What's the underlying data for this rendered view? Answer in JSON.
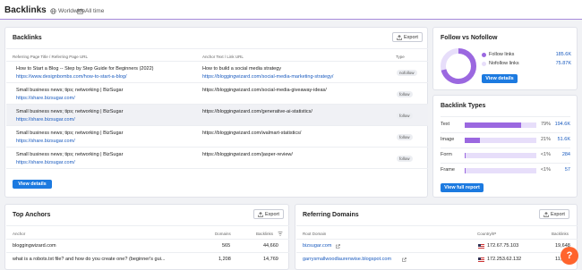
{
  "header": {
    "title": "Backlinks",
    "scope": "Worldwide",
    "period": "All time"
  },
  "backlinks": {
    "title": "Backlinks",
    "export_label": "Export",
    "columns": [
      "Referring Page Title / Referring Page URL",
      "Anchor Text / Link URL",
      "Type"
    ],
    "rows": [
      {
        "title": "How to Start a Blog -- Step by Step Guide for Beginners (2022)",
        "url": "https://www.designbombs.com/how-to-start-a-blog/",
        "anchor": "How to build a social media strategy",
        "link": "https://bloggingwizard.com/social-media-marketing-strategy/",
        "type": "nofollow"
      },
      {
        "title": "Small business news; tips; networking | BizSugar",
        "url": "https://share.bizsugar.com/",
        "anchor": "https://bloggingwizard.com/social-media-giveaway-ideas/",
        "link": "",
        "type": "follow"
      },
      {
        "title": "Small business news; tips; networking | BizSugar",
        "url": "https://share.bizsugar.com/",
        "anchor": "https://bloggingwizard.com/generative-ai-statistics/",
        "link": "",
        "type": "follow"
      },
      {
        "title": "Small business news; tips; networking | BizSugar",
        "url": "https://share.bizsugar.com/",
        "anchor": "https://bloggingwizard.com/walmart-statistics/",
        "link": "",
        "type": "follow"
      },
      {
        "title": "Small business news; tips; networking | BizSugar",
        "url": "https://share.bizsugar.com/",
        "anchor": "https://bloggingwizard.com/jasper-review/",
        "link": "",
        "type": "follow"
      }
    ],
    "details_label": "View details"
  },
  "follow": {
    "title": "Follow vs Nofollow",
    "follow_label": "Follow links",
    "follow_value": "185.6K",
    "follow_fraction": 0.71,
    "nofollow_label": "Nofollow links",
    "nofollow_value": "75.87K",
    "details_label": "View details",
    "colors": {
      "follow": "#9b68e0",
      "nofollow": "#e7defa"
    }
  },
  "types": {
    "title": "Backlink Types",
    "items": [
      {
        "label": "Text",
        "pct": "79%",
        "value": "194.6K",
        "fraction": 0.79
      },
      {
        "label": "Image",
        "pct": "21%",
        "value": "51.6K",
        "fraction": 0.21
      },
      {
        "label": "Form",
        "pct": "<1%",
        "value": "284",
        "fraction": 0.01
      },
      {
        "label": "Frame",
        "pct": "<1%",
        "value": "57",
        "fraction": 0.01
      }
    ],
    "report_label": "View full report"
  },
  "anchors": {
    "title": "Top Anchors",
    "export_label": "Export",
    "columns": [
      "Anchor",
      "Domains",
      "Backlinks"
    ],
    "rows": [
      {
        "anchor": "bloggingwizard.com",
        "domains": "565",
        "backlinks": "44,660"
      },
      {
        "anchor": "what is a robots.txt file? and how do you create one? (beginner's gui...",
        "domains": "1,208",
        "backlinks": "14,769"
      }
    ]
  },
  "domains": {
    "title": "Referring Domains",
    "export_label": "Export",
    "columns": [
      "Root Domain",
      "Country/IP",
      "Backlinks"
    ],
    "rows": [
      {
        "domain": "bizsugar.com",
        "ip": "172.67.75.103",
        "backlinks": "19,648"
      },
      {
        "domain": "garrysmallwoodlaurenwise.blogspot.com",
        "ip": "172.253.62.132",
        "backlinks": "11,..."
      }
    ]
  },
  "help_label": "?"
}
